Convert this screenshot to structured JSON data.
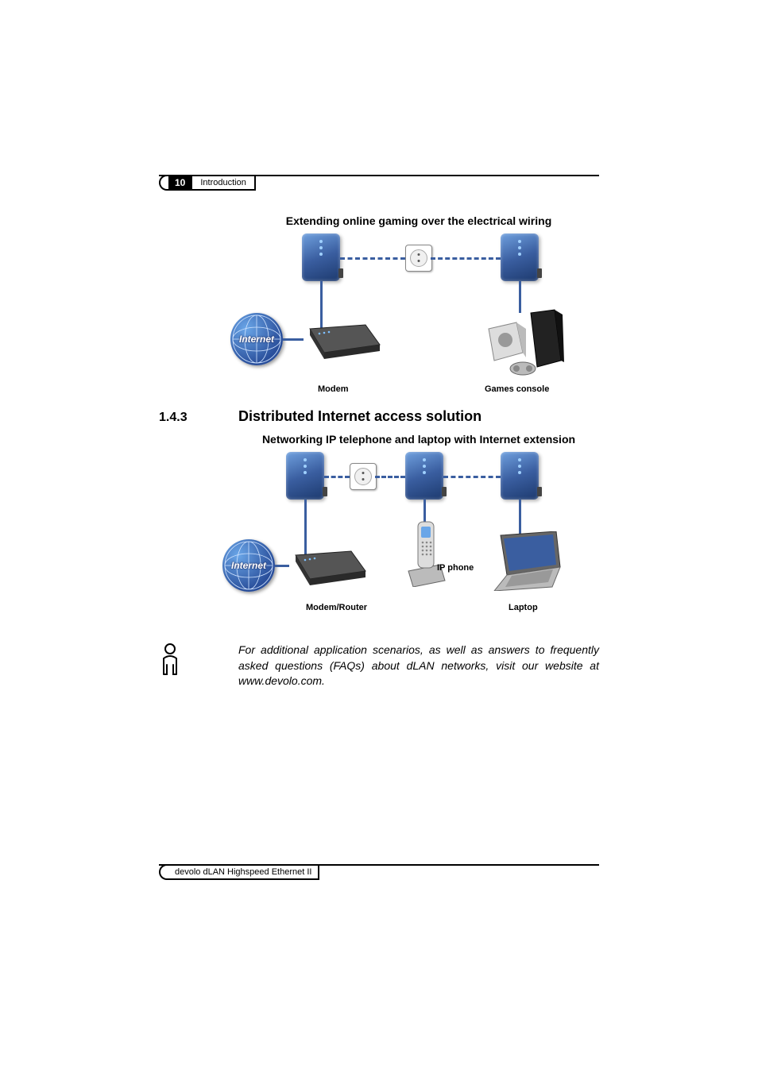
{
  "header": {
    "page_number": "10",
    "chapter": "Introduction"
  },
  "footer": {
    "product": "devolo dLAN Highspeed Ethernet II"
  },
  "diagram1": {
    "caption": "Extending online gaming over the electrical wiring",
    "globe_label": "Internet",
    "modem_label": "Modem",
    "console_label": "Games console"
  },
  "section": {
    "number": "1.4.3",
    "title": "Distributed Internet access solution"
  },
  "diagram2": {
    "caption": "Networking IP telephone and laptop with Internet extension",
    "globe_label": "Internet",
    "router_label": "Modem/Router",
    "ipphone_label": "IP phone",
    "laptop_label": "Laptop"
  },
  "note": {
    "text": "For additional application scenarios, as well as answers to frequently asked questions (FAQs) about dLAN networks, visit our website at www.devolo.com."
  }
}
